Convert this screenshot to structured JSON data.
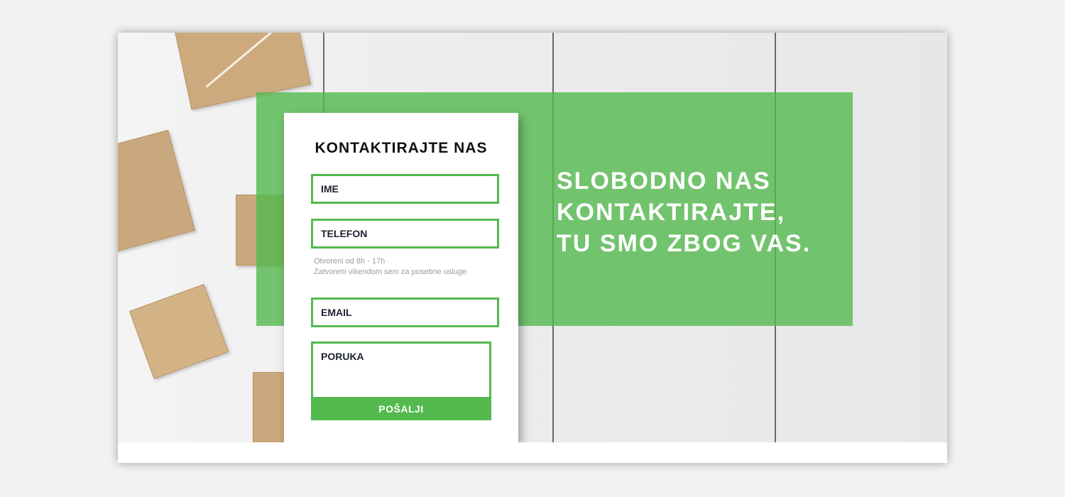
{
  "contact_form": {
    "title": "KONTAKTIRAJTE NAS",
    "name_placeholder": "IME",
    "phone_placeholder": "TELEFON",
    "hours_line1": "Otvoreni od 8h - 17h",
    "hours_line2": "Zatvoreni vikendom sem za posebne usluge",
    "email_placeholder": "EMAIL",
    "message_placeholder": "PORUKA",
    "submit_label": "POŠALJI"
  },
  "tagline": {
    "line1": "SLOBODNO NAS",
    "line2": "KONTAKTIRAJTE,",
    "line3": "TU SMO ZBOG VAS."
  },
  "colors": {
    "accent": "#54b94e",
    "background": "#f2f2f2"
  }
}
